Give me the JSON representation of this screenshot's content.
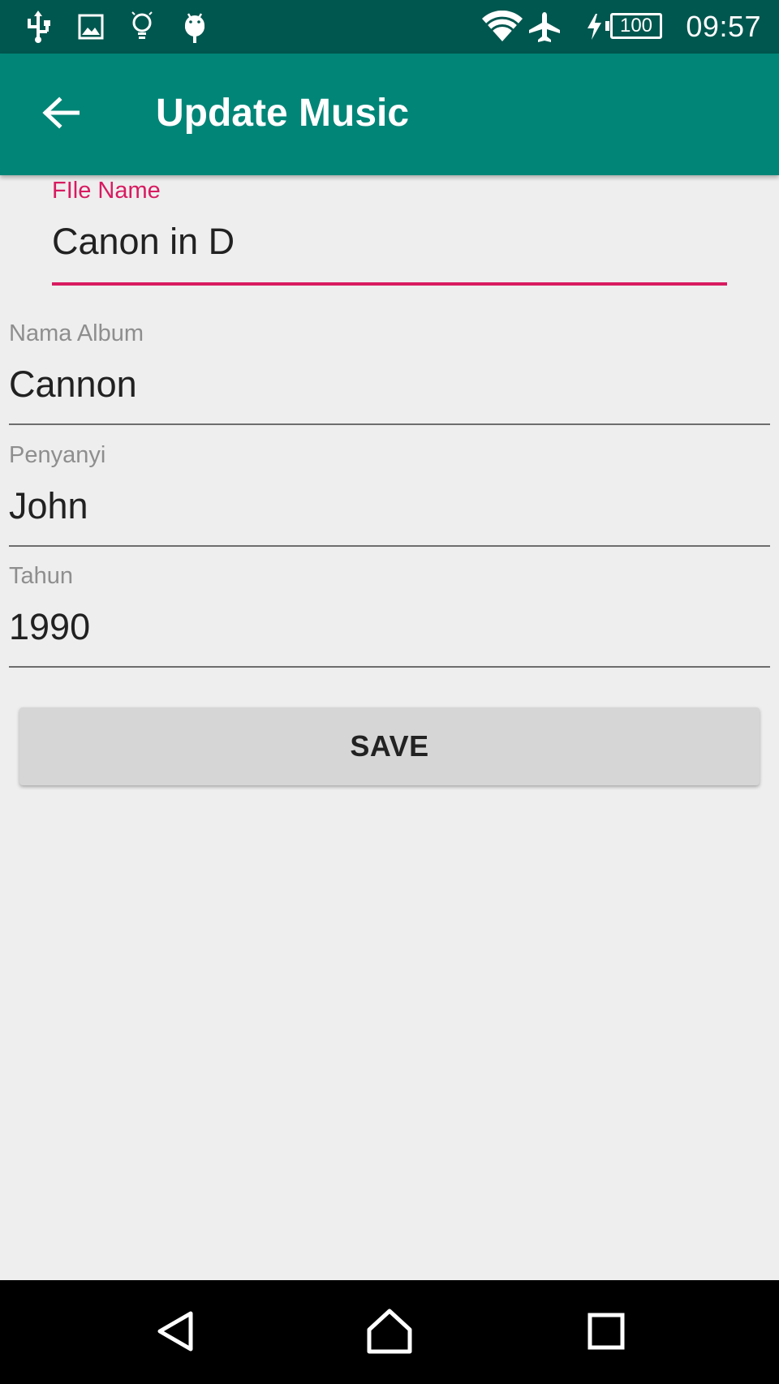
{
  "status_bar": {
    "icons_left": [
      "usb-icon",
      "image-icon",
      "lightbulb-icon",
      "android-icon"
    ],
    "icons_right": [
      "wifi-icon",
      "airplane-icon",
      "charging-icon"
    ],
    "battery_level": "100",
    "time": "09:57"
  },
  "app_bar": {
    "title": "Update Music",
    "back_icon": "arrow-back-icon"
  },
  "form": {
    "file_name": {
      "label": "FIle Name",
      "value": "Canon in D"
    },
    "album": {
      "label": "Nama Album",
      "value": "Cannon"
    },
    "singer": {
      "label": "Penyanyi",
      "value": "John"
    },
    "year": {
      "label": "Tahun",
      "value": "1990"
    },
    "save_label": "SAVE"
  },
  "colors": {
    "status_bar": "#00574f",
    "app_bar": "#008577",
    "accent": "#d81b60",
    "background": "#eeeeee"
  },
  "nav_bar": {
    "icons": [
      "back-triangle-icon",
      "home-icon",
      "recents-icon"
    ]
  }
}
